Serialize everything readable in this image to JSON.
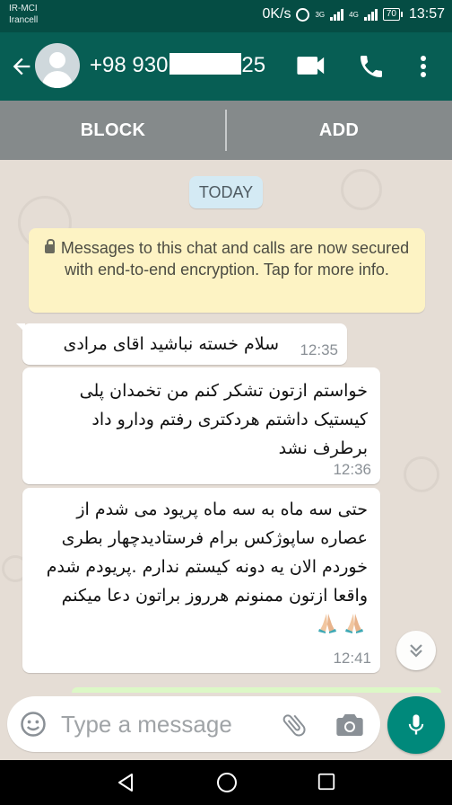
{
  "status_bar": {
    "carrier_line1": "IR-MCI",
    "carrier_line2": "Irancell",
    "net_speed": "0K/s",
    "signal_label_1": "3G",
    "signal_label_2": "4G",
    "battery": "70",
    "time": "13:57"
  },
  "header": {
    "contact_number_prefix": "+98 930",
    "contact_number_suffix": "25",
    "icons": [
      "back-arrow-icon",
      "avatar",
      "video-call-icon",
      "phone-icon",
      "more-vert-icon"
    ]
  },
  "actions": {
    "block_label": "BLOCK",
    "add_label": "ADD"
  },
  "chat": {
    "date_chip": "TODAY",
    "encryption_notice": "Messages to this chat and calls are now secured with end-to-end encryption. Tap for more info.",
    "messages": [
      {
        "text": "سلام خسته نباشید اقای مرادی",
        "time": "12:35"
      },
      {
        "text": "خواستم ازتون تشکر کنم من تخمدان پلی کیستیک داشتم هردکتری رفتم ودارو داد برطرف نشد",
        "time": "12:36"
      },
      {
        "text": "حتی سه ماه به سه ماه  پریود می شدم از عصاره ساپوژکس برام فرستادیدچهار بطری خوردم الان یه دونه کیستم ندارم .پریودم شدم واقعا ازتون ممنونم هرروز براتون دعا میکنم",
        "time": "12:41"
      }
    ]
  },
  "composer": {
    "placeholder": "Type a message"
  },
  "colors": {
    "header": "#075e54",
    "status_bar": "#054d44",
    "action_bar": "#858a8b",
    "chat_bg": "#e5ddd5",
    "notice_bg": "#fdf3c4",
    "date_chip_bg": "#d4eaf4",
    "fab": "#00897b"
  }
}
